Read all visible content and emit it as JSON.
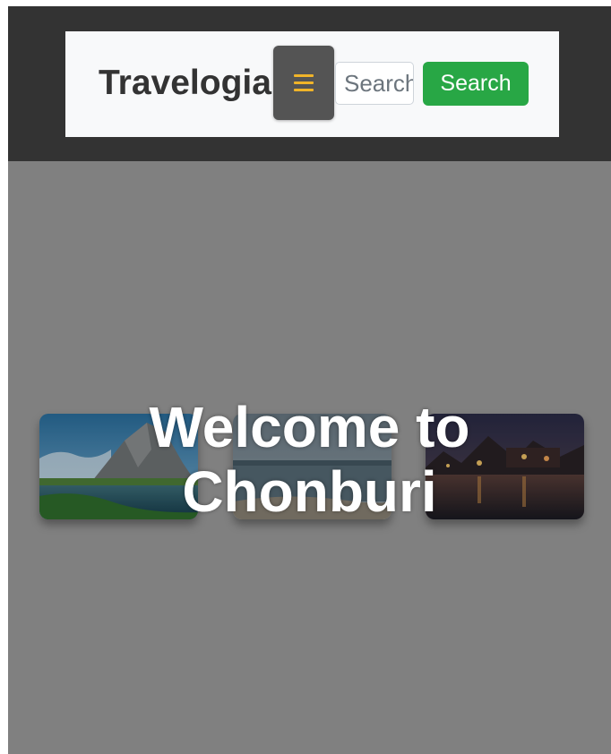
{
  "navbar": {
    "brand": "Travelogia",
    "toggler_icon": "hamburger-icon",
    "search_placeholder": "Search",
    "search_button_label": "Search"
  },
  "hero": {
    "title_line1": "Welcome to",
    "title_line2": "Chonburi"
  },
  "gallery": {
    "images": [
      {
        "name": "mountain-lake-photo"
      },
      {
        "name": "sea-beach-photo"
      },
      {
        "name": "night-town-photo"
      }
    ]
  },
  "colors": {
    "topbar": "#333333",
    "navbar_bg": "#f8f9fa",
    "page_bg": "#808080",
    "toggler_bg": "#545454",
    "toggler_icon": "#f0b429",
    "search_button": "#28a745",
    "hero_text": "#ffffff"
  }
}
